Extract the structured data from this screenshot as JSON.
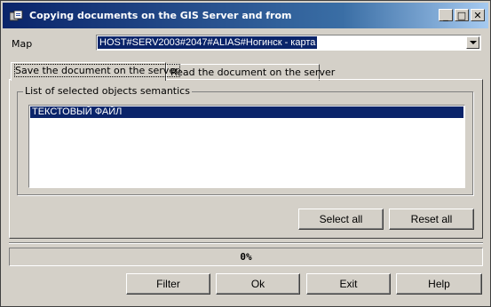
{
  "window": {
    "title": "Copying documents on the GIS Server and from",
    "minimize_glyph": "_",
    "maximize_glyph": "□",
    "close_glyph": "✕"
  },
  "map": {
    "label": "Map",
    "value": "HOST#SERV2003#2047#ALIAS#Ногинск - карта"
  },
  "tabs": [
    {
      "label": "Save the document on the server",
      "active": true
    },
    {
      "label": "Read the document on the server",
      "active": false
    }
  ],
  "semantics": {
    "group_label": "List of selected objects semantics",
    "items": [
      "ТЕКСТОВЫЙ ФАЙЛ"
    ]
  },
  "panel_buttons": {
    "select_all": "Select all",
    "reset_all": "Reset all"
  },
  "progress": {
    "text": "0%",
    "value": 0
  },
  "footer_buttons": {
    "filter": "Filter",
    "ok": "Ok",
    "exit": "Exit",
    "help": "Help"
  },
  "colors": {
    "selection": "#0a246a",
    "face": "#d4d0c8"
  }
}
